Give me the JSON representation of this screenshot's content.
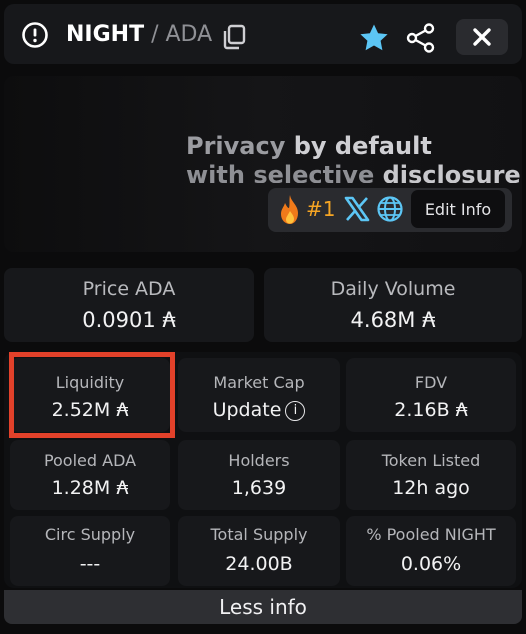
{
  "header": {
    "base_symbol": "NIGHT",
    "separator": " / ",
    "quote_symbol": "ADA",
    "colors": {
      "star": "#5cc6f5",
      "close_bg": "#2a2b2f"
    }
  },
  "banner": {
    "line1_a": "Privacy",
    "line1_b": " by default",
    "line2_a": "with selective ",
    "line2_b": "disclosure",
    "rank": "#1",
    "edit_info_label": "Edit Info",
    "icons": [
      "fire-icon",
      "x-icon",
      "globe-icon"
    ],
    "colors": {
      "rank": "#f5a524",
      "globe": "#5cc6f5"
    }
  },
  "stats": {
    "price": {
      "label": "Price ADA",
      "value": "0.0901 ₳"
    },
    "daily_volume": {
      "label": "Daily Volume",
      "value": "4.68M ₳"
    },
    "liquidity": {
      "label": "Liquidity",
      "value": "2.52M ₳"
    },
    "market_cap": {
      "label": "Market Cap",
      "value": "Update"
    },
    "fdv": {
      "label": "FDV",
      "value": "2.16B ₳"
    },
    "pooled_ada": {
      "label": "Pooled ADA",
      "value": "1.28M ₳"
    },
    "holders": {
      "label": "Holders",
      "value": "1,639"
    },
    "token_listed": {
      "label": "Token Listed",
      "value": "12h ago"
    },
    "circ_supply": {
      "label": "Circ Supply",
      "value": "---"
    },
    "total_supply": {
      "label": "Total Supply",
      "value": "24.00B"
    },
    "pooled_night": {
      "label": "% Pooled NIGHT",
      "value": "0.06%"
    }
  },
  "footer": {
    "less_info_label": "Less info"
  },
  "highlight_color": "#e2412a"
}
